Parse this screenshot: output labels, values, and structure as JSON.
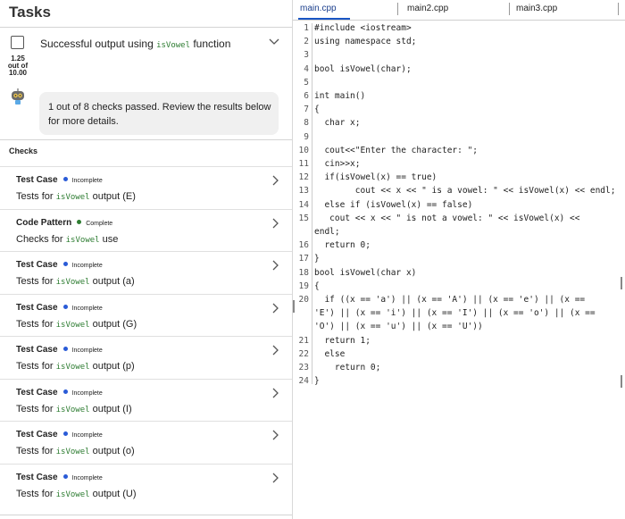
{
  "tasks": {
    "title": "Tasks",
    "task_label_pre": "Successful output using ",
    "task_code": "isVowel",
    "task_label_post": " function",
    "score_value": "1.25",
    "score_of": "out of",
    "score_total": "10.00",
    "message": "1 out of 8 checks passed. Review the results below for more details.",
    "checks_heading": "Checks"
  },
  "checks": [
    {
      "type": "Test Case",
      "status": "Incomplete",
      "status_color": "#2a5bd7",
      "pre": "Tests for ",
      "code": "isVowel",
      "post": " output (E)"
    },
    {
      "type": "Code Pattern",
      "status": "Complete",
      "status_color": "#2e7d32",
      "pre": "Checks for ",
      "code": "isVowel",
      "post": " use"
    },
    {
      "type": "Test Case",
      "status": "Incomplete",
      "status_color": "#2a5bd7",
      "pre": "Tests for ",
      "code": "isVowel",
      "post": " output (a)"
    },
    {
      "type": "Test Case",
      "status": "Incomplete",
      "status_color": "#2a5bd7",
      "pre": "Tests for ",
      "code": "isVowel",
      "post": " output (G)"
    },
    {
      "type": "Test Case",
      "status": "Incomplete",
      "status_color": "#2a5bd7",
      "pre": "Tests for ",
      "code": "isVowel",
      "post": " output (p)"
    },
    {
      "type": "Test Case",
      "status": "Incomplete",
      "status_color": "#2a5bd7",
      "pre": "Tests for ",
      "code": "isVowel",
      "post": " output (I)"
    },
    {
      "type": "Test Case",
      "status": "Incomplete",
      "status_color": "#2a5bd7",
      "pre": "Tests for ",
      "code": "isVowel",
      "post": " output (o)"
    },
    {
      "type": "Test Case",
      "status": "Incomplete",
      "status_color": "#2a5bd7",
      "pre": "Tests for ",
      "code": "isVowel",
      "post": " output (U)"
    }
  ],
  "editor": {
    "tabs": [
      "main.cpp",
      "main2.cpp",
      "main3.cpp"
    ],
    "lines": [
      {
        "n": "1",
        "t": "#include <iostream>"
      },
      {
        "n": "2",
        "t": "using namespace std;"
      },
      {
        "n": "3",
        "t": ""
      },
      {
        "n": "4",
        "t": "bool isVowel(char);"
      },
      {
        "n": "5",
        "t": ""
      },
      {
        "n": "6",
        "t": "int main()"
      },
      {
        "n": "7",
        "t": "{"
      },
      {
        "n": "8",
        "t": "  char x;"
      },
      {
        "n": "9",
        "t": ""
      },
      {
        "n": "10",
        "t": "  cout<<\"Enter the character: \";"
      },
      {
        "n": "11",
        "t": "  cin>>x;"
      },
      {
        "n": "12",
        "t": "  if(isVowel(x) == true)"
      },
      {
        "n": "13",
        "t": "        cout << x << \" is a vowel: \" << isVowel(x) << endl;"
      },
      {
        "n": "14",
        "t": "  else if (isVowel(x) == false)"
      },
      {
        "n": "15",
        "t": "   cout << x << \" is not a vowel: \" << isVowel(x) <<"
      },
      {
        "n": "",
        "t": "endl;"
      },
      {
        "n": "16",
        "t": "  return 0;"
      },
      {
        "n": "17",
        "t": "}"
      },
      {
        "n": "18",
        "t": "bool isVowel(char x)"
      },
      {
        "n": "19",
        "t": "{"
      },
      {
        "n": "20",
        "t": "  if ((x == 'a') || (x == 'A') || (x == 'e') || (x =="
      },
      {
        "n": "",
        "t": "'E') || (x == 'i') || (x == 'I') || (x == 'o') || (x =="
      },
      {
        "n": "",
        "t": "'O') || (x == 'u') || (x == 'U'))"
      },
      {
        "n": "21",
        "t": "  return 1;"
      },
      {
        "n": "22",
        "t": "  else"
      },
      {
        "n": "23",
        "t": "    return 0;"
      },
      {
        "n": "24",
        "t": "}"
      }
    ]
  }
}
